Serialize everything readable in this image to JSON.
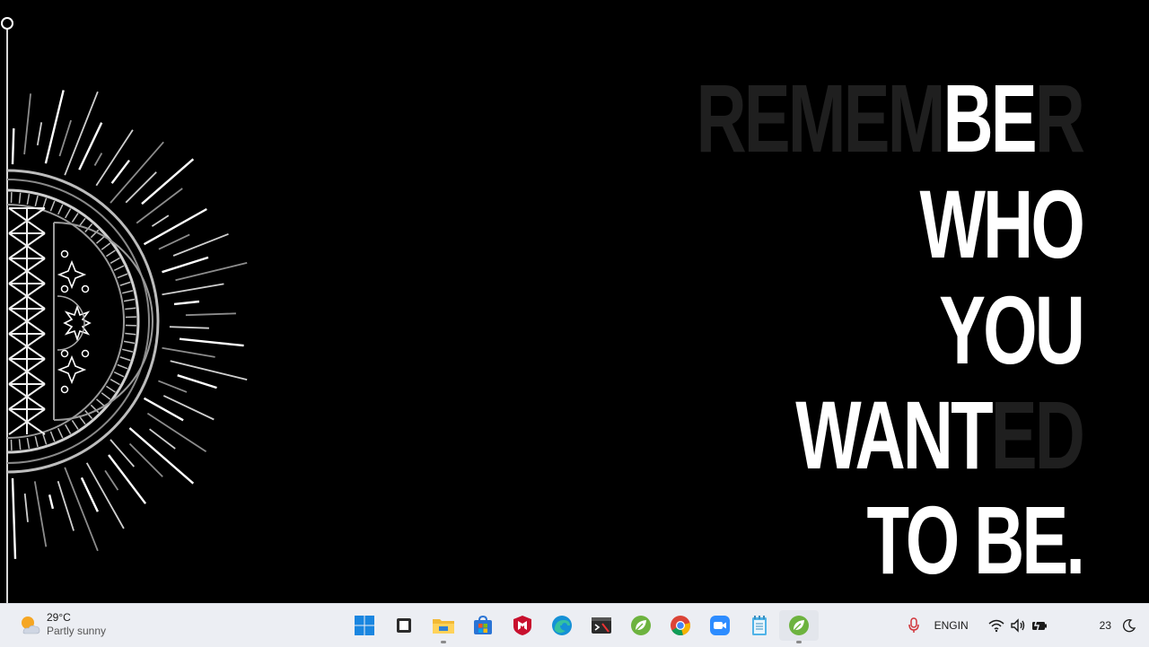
{
  "wallpaper": {
    "quote": {
      "line1_dim_prefix": "REMEM",
      "line1_bright": "BE",
      "line1_dim_suffix": "R",
      "line2": "WHO",
      "line3": "YOU",
      "line4_bright": "WANT",
      "line4_dim_suffix": "ED",
      "line5": "TO BE."
    }
  },
  "taskbar": {
    "weather": {
      "temperature": "29°C",
      "condition": "Partly sunny",
      "icon": "sun-cloud-icon"
    },
    "apps": [
      {
        "name": "start-button",
        "icon": "windows-logo-icon",
        "active": false
      },
      {
        "name": "task-view",
        "icon": "task-view-icon",
        "active": false
      },
      {
        "name": "file-explorer",
        "icon": "folder-icon",
        "active": false,
        "running": true
      },
      {
        "name": "microsoft-store",
        "icon": "store-icon",
        "active": false
      },
      {
        "name": "mcafee",
        "icon": "mcafee-shield-icon",
        "active": false
      },
      {
        "name": "edge",
        "icon": "edge-icon",
        "active": false
      },
      {
        "name": "terminal",
        "icon": "terminal-icon",
        "active": false
      },
      {
        "name": "spring-tool",
        "icon": "leaf-icon",
        "active": false
      },
      {
        "name": "chrome",
        "icon": "chrome-icon",
        "active": false
      },
      {
        "name": "zoom",
        "icon": "video-camera-icon",
        "active": false
      },
      {
        "name": "notepad",
        "icon": "notepad-icon",
        "active": false
      },
      {
        "name": "spring-tool-2",
        "icon": "leaf-icon",
        "active": true,
        "running": true
      }
    ],
    "tray": {
      "language_line1": "ENG",
      "language_line2": "IN",
      "clock": "23"
    }
  },
  "colors": {
    "taskbar_bg": "#eceef3",
    "accent_blue": "#0a74da"
  }
}
